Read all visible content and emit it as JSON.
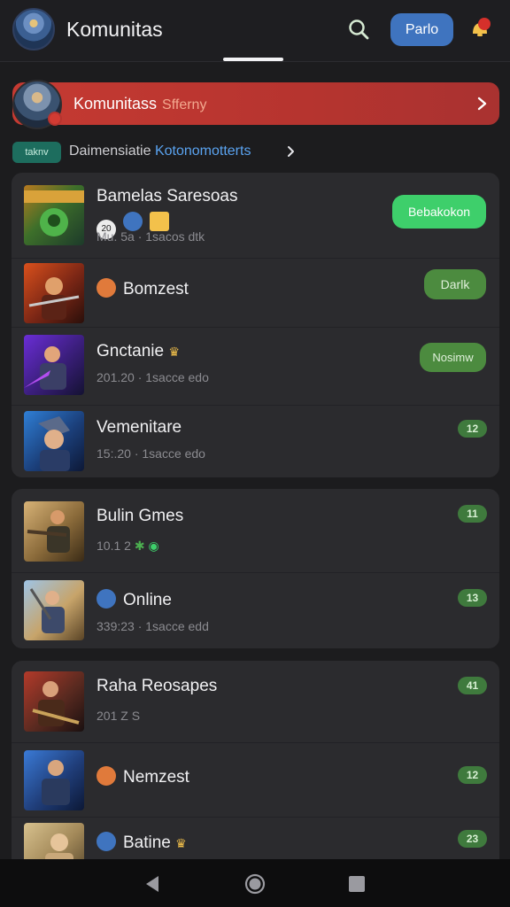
{
  "header": {
    "title": "Komunitas",
    "action_label": "Parlo"
  },
  "banner": {
    "title": "Komunitass",
    "subtitle": "Sfferny"
  },
  "section": {
    "chip": "taknv",
    "text": "Daimensiatie",
    "link": "Kotonomotterts"
  },
  "groups": [
    {
      "rows": [
        {
          "title": "Bamelas Saresoas",
          "meta": "Mu. 5a · 1sacos dtk",
          "action": "Bebakokon",
          "badges": [
            "20"
          ]
        },
        {
          "title": "Bomzest",
          "meta": "",
          "action": "Darlk"
        },
        {
          "title": "Gnctanie",
          "meta": "201.20 · 1sacce edo",
          "action": "Nosimw"
        },
        {
          "title": "Vemenitare",
          "meta": "15:.20 · 1sacce edo",
          "count": "12"
        }
      ]
    },
    {
      "rows": [
        {
          "title": "Bulin Gmes",
          "meta": "10.1 2",
          "count": "11"
        },
        {
          "title": "Online",
          "meta": "339:23 · 1sacce edd",
          "count": "13"
        }
      ]
    },
    {
      "rows": [
        {
          "title": "Raha Reosapes",
          "meta": "201 Z S",
          "count": "41"
        },
        {
          "title": "Nemzest",
          "meta": "",
          "count": "12"
        },
        {
          "title": "Batine",
          "meta": "",
          "count": "23"
        }
      ]
    }
  ],
  "colors": {
    "accent_blue": "#3f74bf",
    "banner_red": "#c53a32",
    "success_green": "#3ecf6b",
    "olive_green": "#4c8b3f"
  },
  "icons": {
    "search": "search-icon",
    "notification": "notification-icon",
    "chevron": "chevron-right-icon",
    "back": "back-icon",
    "home": "home-icon",
    "recents": "recents-icon"
  }
}
